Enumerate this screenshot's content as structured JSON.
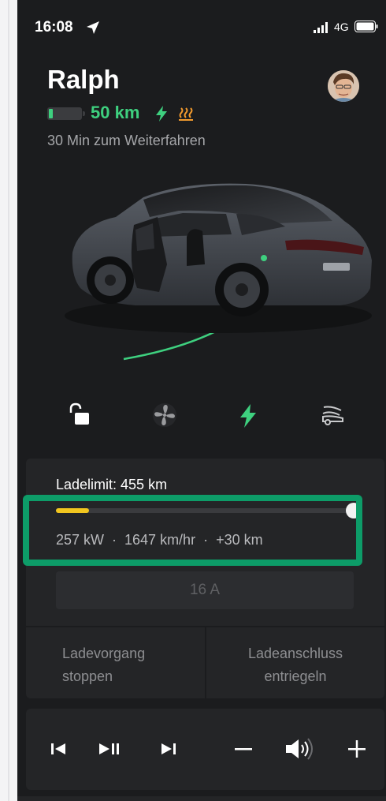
{
  "status_bar": {
    "time": "16:08",
    "network": "4G",
    "location_icon": "location-arrow-icon",
    "signal_icon": "cellular-signal-icon",
    "battery_icon": "phone-battery-icon"
  },
  "vehicle": {
    "name": "Ralph",
    "range": "50 km",
    "battery_level_fraction": 0.11,
    "charge_eta": "30 Min zum Weiterfahren",
    "status_icons": [
      "charging-bolt-icon",
      "seat-heater-icon"
    ]
  },
  "controls": [
    {
      "id": "lock",
      "icon": "unlocked-padlock-icon"
    },
    {
      "id": "climate",
      "icon": "fan-icon"
    },
    {
      "id": "charge",
      "icon": "charging-bolt-icon"
    },
    {
      "id": "frunk",
      "icon": "car-frunk-icon"
    }
  ],
  "charging": {
    "limit_label": "Ladelimit: 455 km",
    "current_charge_fraction": 0.11,
    "charge_limit_fraction": 1.0,
    "stats": "257 kW  ·  1647 km/hr  ·  +30 km",
    "amps": "16 A",
    "stop_label_line1": "Ladevorgang",
    "stop_label_line2": "stoppen",
    "unlock_label_line1": "Ladeanschluss",
    "unlock_label_line2": "entriegeln"
  },
  "media": {
    "buttons": [
      "previous-track-icon",
      "play-pause-icon",
      "next-track-icon",
      "volume-down-icon",
      "speaker-icon",
      "volume-up-icon"
    ]
  },
  "colors": {
    "background": "#1b1c1e",
    "panel": "#242527",
    "accent_green": "#3ed07f",
    "heater_orange": "#f29a2e",
    "slider_yellow": "#f1c61f",
    "highlight_green": "#0d9c68"
  }
}
